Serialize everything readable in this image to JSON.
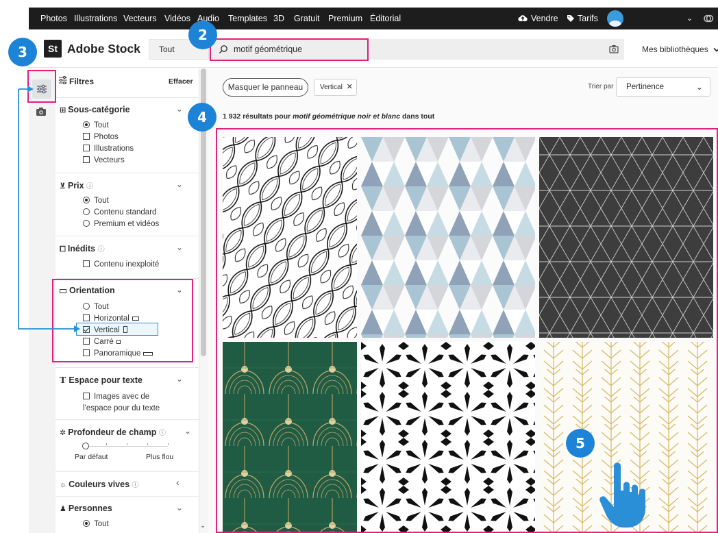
{
  "topnav": {
    "items": [
      "Photos",
      "Illustrations",
      "Vecteurs",
      "Vidéos",
      "Audio",
      "Templates",
      "3D",
      "Gratuit",
      "Premium",
      "Éditorial"
    ],
    "sell": "Vendre",
    "pricing": "Tarifs"
  },
  "header": {
    "logo_badge": "St",
    "logo_text": "Adobe Stock",
    "scope": "Tout",
    "search_value": "motif géométrique",
    "libraries": "Mes bibliothèques"
  },
  "filters": {
    "title": "Filtres",
    "clear": "Effacer",
    "sections": {
      "subcategory": {
        "title": "Sous-catégorie",
        "options": [
          "Tout",
          "Photos",
          "Illustrations",
          "Vecteurs"
        ]
      },
      "price": {
        "title": "Prix",
        "options": [
          "Tout",
          "Contenu standard",
          "Premium et vidéos"
        ]
      },
      "unreleased": {
        "title": "Inédits",
        "options": [
          "Contenu inexploité"
        ]
      },
      "orientation": {
        "title": "Orientation",
        "options": [
          "Tout",
          "Horizontal",
          "Vertical",
          "Carré",
          "Panoramique"
        ]
      },
      "copyspace": {
        "title": "Espace pour texte",
        "options": [
          "Images avec de",
          "l'espace pour du texte"
        ]
      },
      "depth": {
        "title": "Profondeur de champ",
        "min_label": "Par défaut",
        "max_label": "Plus flou",
        "value": 0
      },
      "vivid": {
        "title": "Couleurs vives"
      },
      "people": {
        "title": "Personnes",
        "options": [
          "Tout"
        ]
      }
    }
  },
  "main": {
    "hide_panel": "Masquer le panneau",
    "chip": "Vertical",
    "sort_label": "Trier par",
    "sort_value": "Pertinence",
    "results_count": "1 932 résultats pour ",
    "results_query": "motif géométrique noir et blanc",
    "results_suffix": " dans tout"
  },
  "callouts": [
    "2",
    "3",
    "4",
    "5"
  ],
  "colors": {
    "callout": "#1d83d6",
    "highlight": "#e0207f",
    "topnav_bg": "#1d1d1d",
    "selected_outline": "#2b8fd6"
  }
}
